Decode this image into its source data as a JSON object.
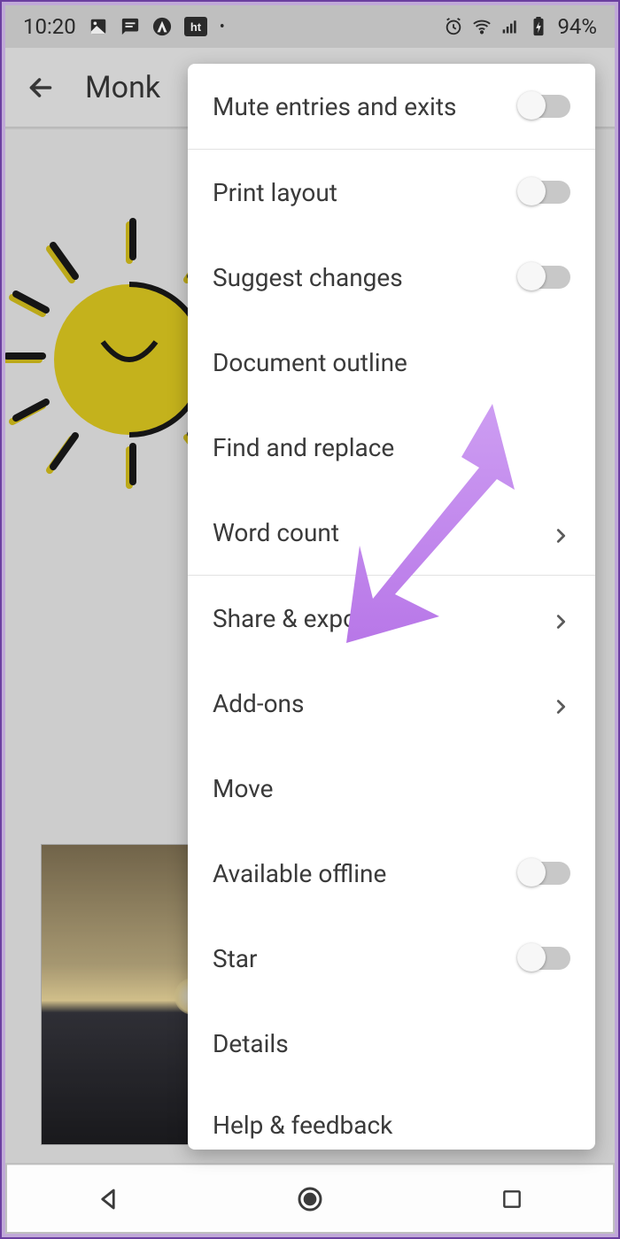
{
  "status": {
    "time": "10:20",
    "battery": "94%"
  },
  "appbar": {
    "title": "Monk"
  },
  "menu": {
    "mute": "Mute entries and exits",
    "print": "Print layout",
    "suggest": "Suggest changes",
    "outline": "Document outline",
    "find": "Find and replace",
    "wordcount": "Word count",
    "share": "Share & export",
    "addons": "Add-ons",
    "move": "Move",
    "offline": "Available offline",
    "star": "Star",
    "details": "Details",
    "help": "Help & feedback"
  }
}
